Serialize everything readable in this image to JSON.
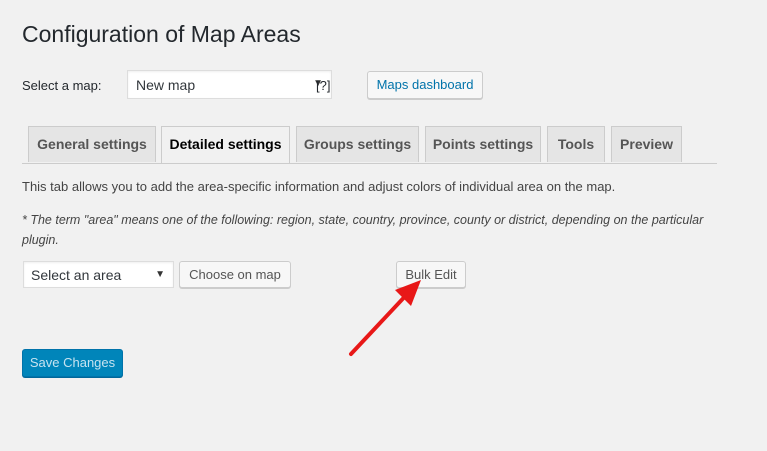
{
  "page": {
    "title": "Configuration of Map Areas"
  },
  "map_select": {
    "label": "Select a map:",
    "value": "New map",
    "help": "[?]",
    "dashboard_button": "Maps dashboard"
  },
  "tabs": [
    {
      "label": "General settings",
      "active": false
    },
    {
      "label": "Detailed settings",
      "active": true
    },
    {
      "label": "Groups settings",
      "active": false
    },
    {
      "label": "Points settings",
      "active": false
    },
    {
      "label": "Tools",
      "active": false
    },
    {
      "label": "Preview",
      "active": false
    }
  ],
  "content": {
    "description": "This tab allows you to add the area-specific information and adjust colors of individual area on the map.",
    "note": "* The term \"area\" means one of the following: region, state, country, province, county or district, depending on the particular plugin.",
    "area_select_value": "Select an area",
    "choose_on_map_button": "Choose on map",
    "bulk_edit_button": "Bulk Edit"
  },
  "footer": {
    "save_button": "Save Changes"
  },
  "annotation": {
    "arrow_color": "#e81818"
  },
  "colors": {
    "primary": "#0085ba",
    "link": "#0073aa",
    "background": "#f1f1f1"
  }
}
